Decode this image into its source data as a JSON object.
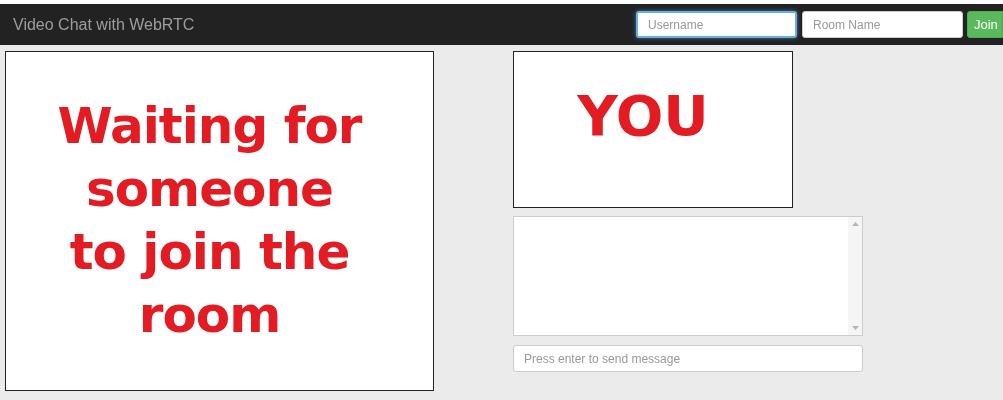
{
  "navbar": {
    "title": "Video Chat with WebRTC",
    "username": {
      "placeholder": "Username",
      "focused": true
    },
    "room": {
      "placeholder": "Room Name",
      "focused": false
    },
    "join_button": "Join"
  },
  "remote_video": {
    "message": "Waiting for\nsomeone\nto join the\nroom"
  },
  "local_video": {
    "message": "YOU"
  },
  "chat": {
    "message_input": {
      "placeholder": "Press enter to send message"
    }
  }
}
